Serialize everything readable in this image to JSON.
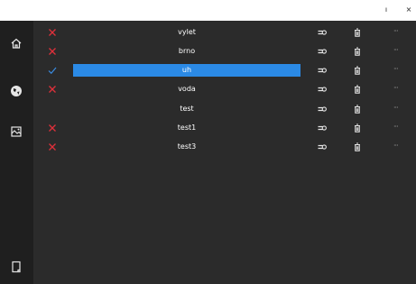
{
  "window": {
    "minimize_label": "ı",
    "close_label": "×"
  },
  "sidebar": {
    "items": [
      {
        "icon": "home-icon"
      },
      {
        "icon": "globe-icon"
      },
      {
        "icon": "gallery-icon"
      },
      {
        "icon": "page-icon"
      }
    ]
  },
  "list": {
    "items": [
      {
        "name": "vylet",
        "status": "cross",
        "selected": false,
        "actions_visible": true
      },
      {
        "name": "brno",
        "status": "cross",
        "selected": false,
        "actions_visible": true
      },
      {
        "name": "uh",
        "status": "check",
        "selected": true,
        "actions_visible": true
      },
      {
        "name": "voda",
        "status": "cross",
        "selected": false,
        "actions_visible": true
      },
      {
        "name": "test",
        "status": "none",
        "selected": false,
        "actions_visible": true
      },
      {
        "name": "test1",
        "status": "cross",
        "selected": false,
        "actions_visible": true
      },
      {
        "name": "test3",
        "status": "cross",
        "selected": false,
        "actions_visible": true
      }
    ],
    "more_label": "···"
  },
  "colors": {
    "cross": "#e0303a",
    "check": "#3a8be0",
    "selected": "#2b8ae6",
    "sidebar_bg": "#1f1f1f",
    "main_bg": "#2b2b2b"
  }
}
